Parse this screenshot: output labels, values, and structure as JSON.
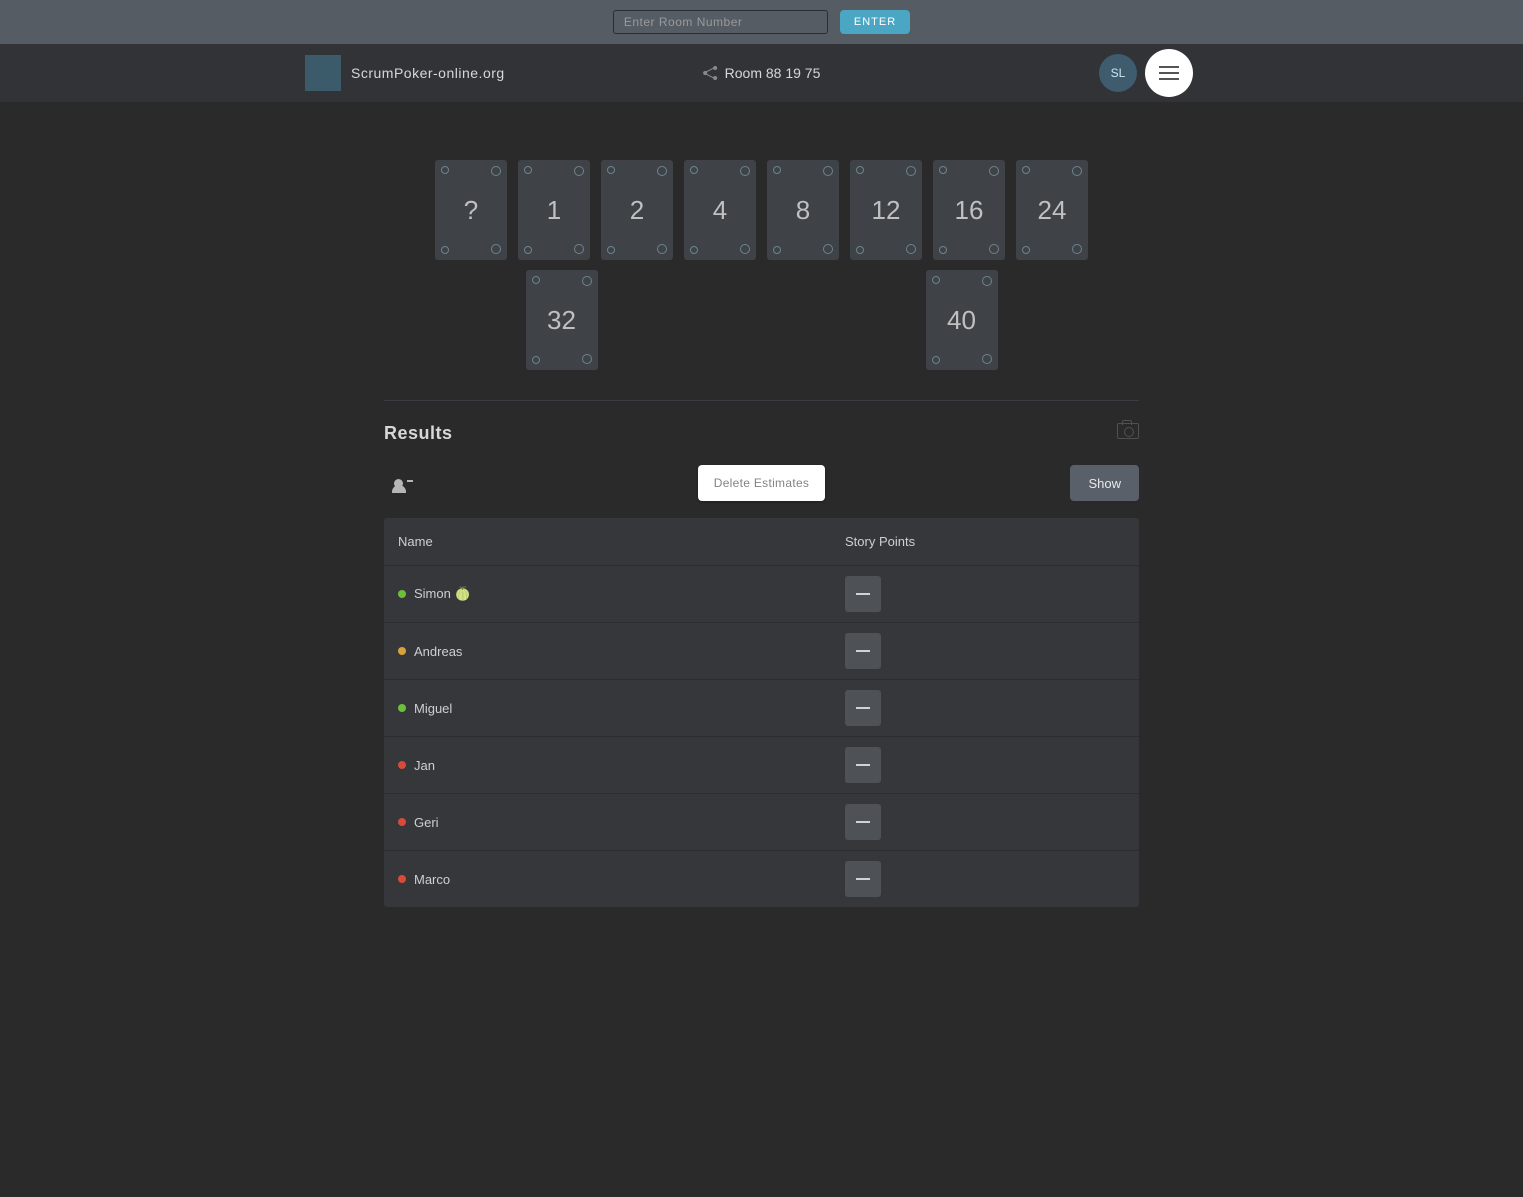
{
  "topbar": {
    "room_placeholder": "Enter Room Number",
    "enter_label": "ENTER"
  },
  "header": {
    "app_title": "ScrumPoker-online.org",
    "room_label": "Room 88 19 75",
    "user_initials": "SL"
  },
  "cards_row1": [
    "?",
    "1",
    "2",
    "4",
    "8",
    "12",
    "16",
    "24"
  ],
  "cards_row2": [
    "32",
    "40"
  ],
  "results": {
    "heading": "Results",
    "delete_label": "Delete Estimates",
    "show_label": "Show",
    "columns": {
      "name": "Name",
      "story_points": "Story Points"
    },
    "players": [
      {
        "name": "Simon 🍈",
        "status": "green",
        "points": "—"
      },
      {
        "name": "Andreas",
        "status": "orange",
        "points": "—"
      },
      {
        "name": "Miguel",
        "status": "green",
        "points": "—"
      },
      {
        "name": "Jan",
        "status": "red",
        "points": "—"
      },
      {
        "name": "Geri",
        "status": "red",
        "points": "—"
      },
      {
        "name": "Marco",
        "status": "red",
        "points": "—"
      }
    ]
  }
}
